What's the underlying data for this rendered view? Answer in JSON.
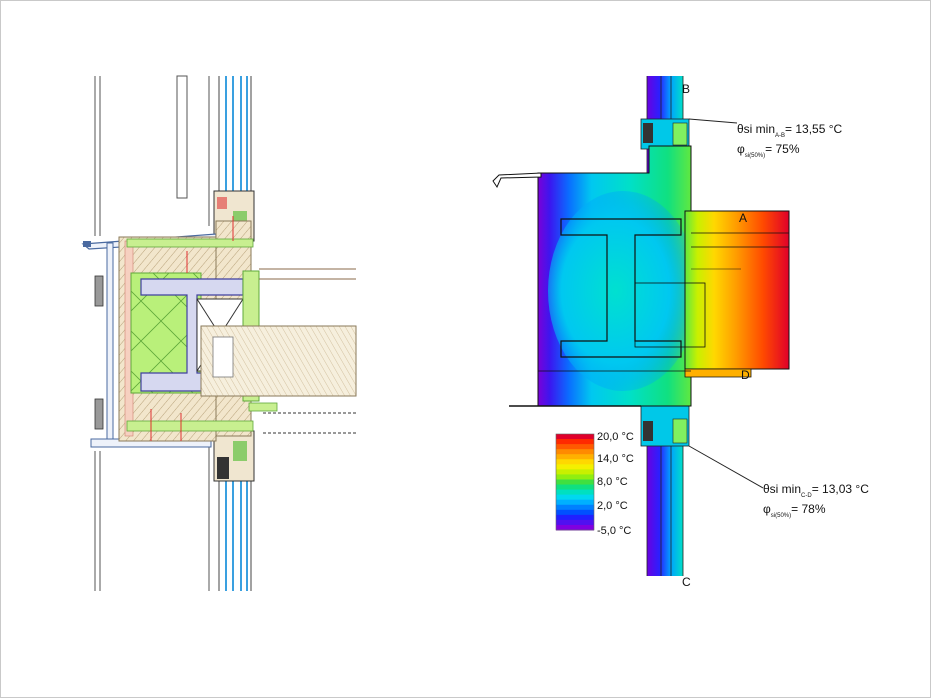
{
  "points": {
    "a": "A",
    "b": "B",
    "c": "C",
    "d": "D"
  },
  "annotation_top": {
    "theta_main": "θsi min",
    "theta_sub": "A-B",
    "theta_value": "= 13,55 °C",
    "phi_main": "φ",
    "phi_sub": "si(50%)",
    "phi_value": "= 75%"
  },
  "annotation_bottom": {
    "theta_main": "θsi min",
    "theta_sub": "C-D",
    "theta_value": "= 13,03 °C",
    "phi_main": "φ",
    "phi_sub": "si(50%)",
    "phi_value": "= 78%"
  },
  "legend": {
    "ticks": [
      "20,0 °C",
      "14,0 °C",
      "8,0 °C",
      "2,0 °C",
      "-5,0 °C"
    ],
    "colors": [
      "#e0002a",
      "#ff2a00",
      "#ff5a00",
      "#ff8a00",
      "#ffb000",
      "#ffd800",
      "#f4f000",
      "#c8f000",
      "#90ee10",
      "#40e040",
      "#10e080",
      "#00e0c0",
      "#00d8f0",
      "#00b0ff",
      "#0080ff",
      "#0050ff",
      "#2020ff",
      "#5010f0",
      "#8000e0"
    ]
  }
}
